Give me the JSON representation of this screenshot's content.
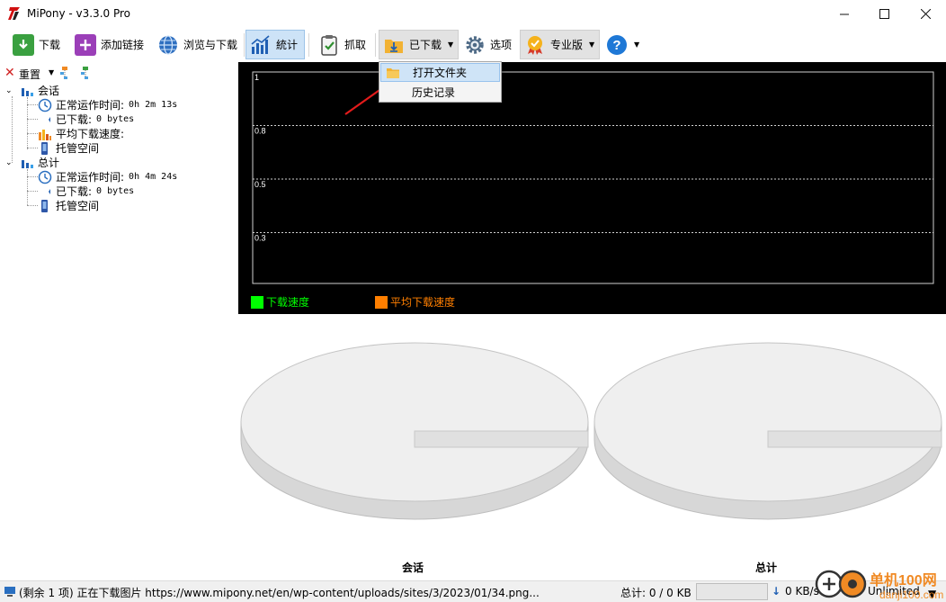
{
  "window": {
    "title": "MiPony - v3.3.0 Pro"
  },
  "toolbar": {
    "download": "下载",
    "add_link": "添加链接",
    "browse_download": "浏览与下载",
    "stats": "統计",
    "grab": "抓取",
    "downloaded": "已下载",
    "options": "选项",
    "pro": "专业版"
  },
  "menu": {
    "open_folder": "打开文件夹",
    "history": "历史记录"
  },
  "left_panel": {
    "reset": "重置",
    "session": {
      "label": "会话",
      "uptime_label": "正常运作时间:",
      "uptime_value": "0h 2m 13s",
      "downloaded_label": "已下载:",
      "downloaded_value": "0 bytes",
      "avg_speed_label": "平均下载速度:",
      "hosting_label": "托管空间"
    },
    "total": {
      "label": "总计",
      "uptime_label": "正常运作时间:",
      "uptime_value": "0h 4m 24s",
      "downloaded_label": "已下载:",
      "downloaded_value": "0 bytes",
      "hosting_label": "托管空间"
    }
  },
  "chart_data": {
    "type": "line",
    "y_ticks": [
      "1",
      "0.8",
      "0.5",
      "0.3"
    ],
    "series": [
      {
        "name": "下载速度",
        "color": "#00ff00",
        "values": []
      },
      {
        "name": "平均下载速度",
        "color": "#ff7f00",
        "values": []
      }
    ],
    "grid": true,
    "legend_position": "bottom-left"
  },
  "pies": {
    "session_label": "会话",
    "total_label": "总计"
  },
  "statusbar": {
    "message": "(剩余 1 项) 正在下载图片 https://www.mipony.net/en/wp-content/uploads/sites/3/2023/01/34.png...",
    "total": "总计: 0 / 0 KB",
    "speed": "0 KB/s",
    "limit": "Unlimited"
  },
  "watermark": {
    "text": "单机100网",
    "url": "danji100.com"
  }
}
